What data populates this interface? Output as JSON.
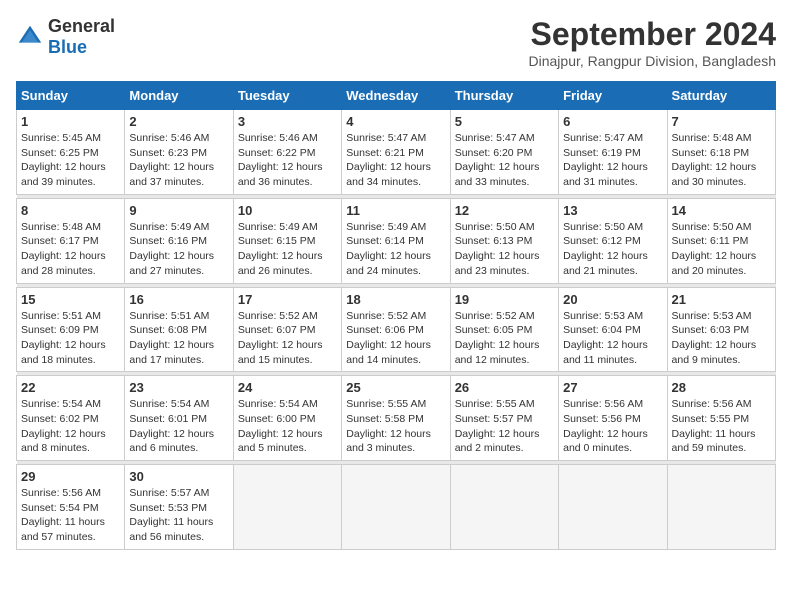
{
  "logo": {
    "general": "General",
    "blue": "Blue"
  },
  "header": {
    "month_year": "September 2024",
    "location": "Dinajpur, Rangpur Division, Bangladesh"
  },
  "weekdays": [
    "Sunday",
    "Monday",
    "Tuesday",
    "Wednesday",
    "Thursday",
    "Friday",
    "Saturday"
  ],
  "weeks": [
    [
      {
        "day": "1",
        "sunrise": "5:45 AM",
        "sunset": "6:25 PM",
        "daylight": "12 hours and 39 minutes."
      },
      {
        "day": "2",
        "sunrise": "5:46 AM",
        "sunset": "6:23 PM",
        "daylight": "12 hours and 37 minutes."
      },
      {
        "day": "3",
        "sunrise": "5:46 AM",
        "sunset": "6:22 PM",
        "daylight": "12 hours and 36 minutes."
      },
      {
        "day": "4",
        "sunrise": "5:47 AM",
        "sunset": "6:21 PM",
        "daylight": "12 hours and 34 minutes."
      },
      {
        "day": "5",
        "sunrise": "5:47 AM",
        "sunset": "6:20 PM",
        "daylight": "12 hours and 33 minutes."
      },
      {
        "day": "6",
        "sunrise": "5:47 AM",
        "sunset": "6:19 PM",
        "daylight": "12 hours and 31 minutes."
      },
      {
        "day": "7",
        "sunrise": "5:48 AM",
        "sunset": "6:18 PM",
        "daylight": "12 hours and 30 minutes."
      }
    ],
    [
      {
        "day": "8",
        "sunrise": "5:48 AM",
        "sunset": "6:17 PM",
        "daylight": "12 hours and 28 minutes."
      },
      {
        "day": "9",
        "sunrise": "5:49 AM",
        "sunset": "6:16 PM",
        "daylight": "12 hours and 27 minutes."
      },
      {
        "day": "10",
        "sunrise": "5:49 AM",
        "sunset": "6:15 PM",
        "daylight": "12 hours and 26 minutes."
      },
      {
        "day": "11",
        "sunrise": "5:49 AM",
        "sunset": "6:14 PM",
        "daylight": "12 hours and 24 minutes."
      },
      {
        "day": "12",
        "sunrise": "5:50 AM",
        "sunset": "6:13 PM",
        "daylight": "12 hours and 23 minutes."
      },
      {
        "day": "13",
        "sunrise": "5:50 AM",
        "sunset": "6:12 PM",
        "daylight": "12 hours and 21 minutes."
      },
      {
        "day": "14",
        "sunrise": "5:50 AM",
        "sunset": "6:11 PM",
        "daylight": "12 hours and 20 minutes."
      }
    ],
    [
      {
        "day": "15",
        "sunrise": "5:51 AM",
        "sunset": "6:09 PM",
        "daylight": "12 hours and 18 minutes."
      },
      {
        "day": "16",
        "sunrise": "5:51 AM",
        "sunset": "6:08 PM",
        "daylight": "12 hours and 17 minutes."
      },
      {
        "day": "17",
        "sunrise": "5:52 AM",
        "sunset": "6:07 PM",
        "daylight": "12 hours and 15 minutes."
      },
      {
        "day": "18",
        "sunrise": "5:52 AM",
        "sunset": "6:06 PM",
        "daylight": "12 hours and 14 minutes."
      },
      {
        "day": "19",
        "sunrise": "5:52 AM",
        "sunset": "6:05 PM",
        "daylight": "12 hours and 12 minutes."
      },
      {
        "day": "20",
        "sunrise": "5:53 AM",
        "sunset": "6:04 PM",
        "daylight": "12 hours and 11 minutes."
      },
      {
        "day": "21",
        "sunrise": "5:53 AM",
        "sunset": "6:03 PM",
        "daylight": "12 hours and 9 minutes."
      }
    ],
    [
      {
        "day": "22",
        "sunrise": "5:54 AM",
        "sunset": "6:02 PM",
        "daylight": "12 hours and 8 minutes."
      },
      {
        "day": "23",
        "sunrise": "5:54 AM",
        "sunset": "6:01 PM",
        "daylight": "12 hours and 6 minutes."
      },
      {
        "day": "24",
        "sunrise": "5:54 AM",
        "sunset": "6:00 PM",
        "daylight": "12 hours and 5 minutes."
      },
      {
        "day": "25",
        "sunrise": "5:55 AM",
        "sunset": "5:58 PM",
        "daylight": "12 hours and 3 minutes."
      },
      {
        "day": "26",
        "sunrise": "5:55 AM",
        "sunset": "5:57 PM",
        "daylight": "12 hours and 2 minutes."
      },
      {
        "day": "27",
        "sunrise": "5:56 AM",
        "sunset": "5:56 PM",
        "daylight": "12 hours and 0 minutes."
      },
      {
        "day": "28",
        "sunrise": "5:56 AM",
        "sunset": "5:55 PM",
        "daylight": "11 hours and 59 minutes."
      }
    ],
    [
      {
        "day": "29",
        "sunrise": "5:56 AM",
        "sunset": "5:54 PM",
        "daylight": "11 hours and 57 minutes."
      },
      {
        "day": "30",
        "sunrise": "5:57 AM",
        "sunset": "5:53 PM",
        "daylight": "11 hours and 56 minutes."
      },
      null,
      null,
      null,
      null,
      null
    ]
  ],
  "labels": {
    "sunrise": "Sunrise:",
    "sunset": "Sunset:",
    "daylight": "Daylight:"
  }
}
